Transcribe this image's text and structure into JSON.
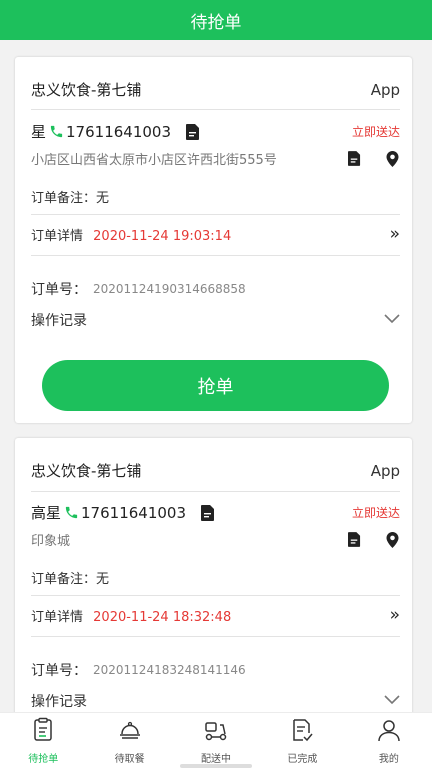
{
  "header": {
    "title": "待抢单"
  },
  "orders": [
    {
      "shop": "忠义饮食-第七铺",
      "source": "App",
      "customer": "星",
      "phone": "17611641003",
      "delivery": "立即送达",
      "address": "小店区山西省太原市小店区许西北街555号",
      "note_label": "订单备注：",
      "note": "无",
      "detail_label": "订单详情",
      "detail_time": "2020-11-24 19:03:14",
      "order_no_label": "订单号：",
      "order_no": "20201124190314668858",
      "log_label": "操作记录",
      "grab_label": "抢单"
    },
    {
      "shop": "忠义饮食-第七铺",
      "source": "App",
      "customer": "高星",
      "phone": "17611641003",
      "delivery": "立即送达",
      "address": "印象城",
      "note_label": "订单备注：",
      "note": "无",
      "detail_label": "订单详情",
      "detail_time": "2020-11-24 18:32:48",
      "order_no_label": "订单号：",
      "order_no": "20201124183248141146",
      "log_label": "操作记录"
    }
  ],
  "tabs": [
    {
      "label": "待抢单",
      "icon": "order-list-icon",
      "active": true
    },
    {
      "label": "待取餐",
      "icon": "cloche-icon",
      "active": false
    },
    {
      "label": "配送中",
      "icon": "scooter-icon",
      "active": false
    },
    {
      "label": "已完成",
      "icon": "done-doc-icon",
      "active": false
    },
    {
      "label": "我的",
      "icon": "user-icon",
      "active": false
    }
  ],
  "colors": {
    "accent": "#1dc05c",
    "danger": "#e53935"
  }
}
